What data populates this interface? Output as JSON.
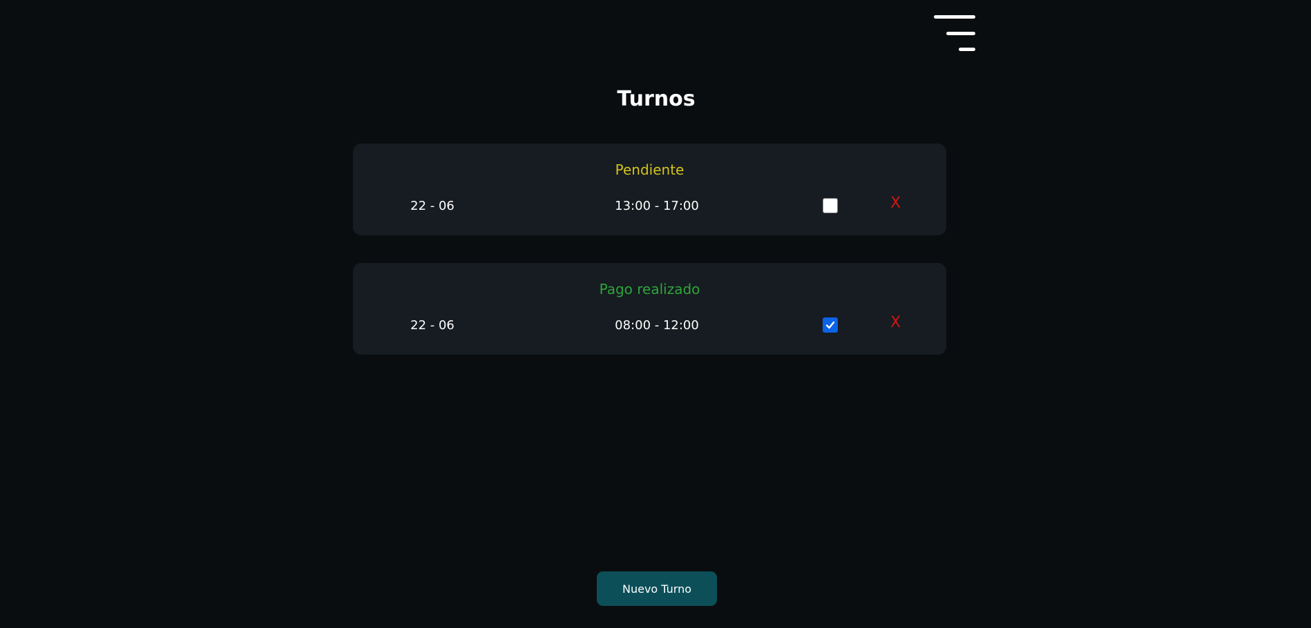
{
  "header": {
    "menu_icon": "hamburger-menu-icon"
  },
  "page": {
    "title": "Turnos"
  },
  "shifts": [
    {
      "status": "Pendiente",
      "status_color": "#d4c31f",
      "date": "22 - 06",
      "time": "13:00 - 17:00",
      "checked": false,
      "delete_label": "X"
    },
    {
      "status": "Pago realizado",
      "status_color": "#2fa43a",
      "date": "22 - 06",
      "time": "08:00 - 12:00",
      "checked": true,
      "delete_label": "X"
    }
  ],
  "footer": {
    "new_button_label": "Nuevo Turno"
  },
  "colors": {
    "background": "#0a0d0f",
    "card": "#161c21",
    "delete": "#d11515",
    "checkbox_checked": "#0b63e6",
    "button": "#0c4f59"
  }
}
